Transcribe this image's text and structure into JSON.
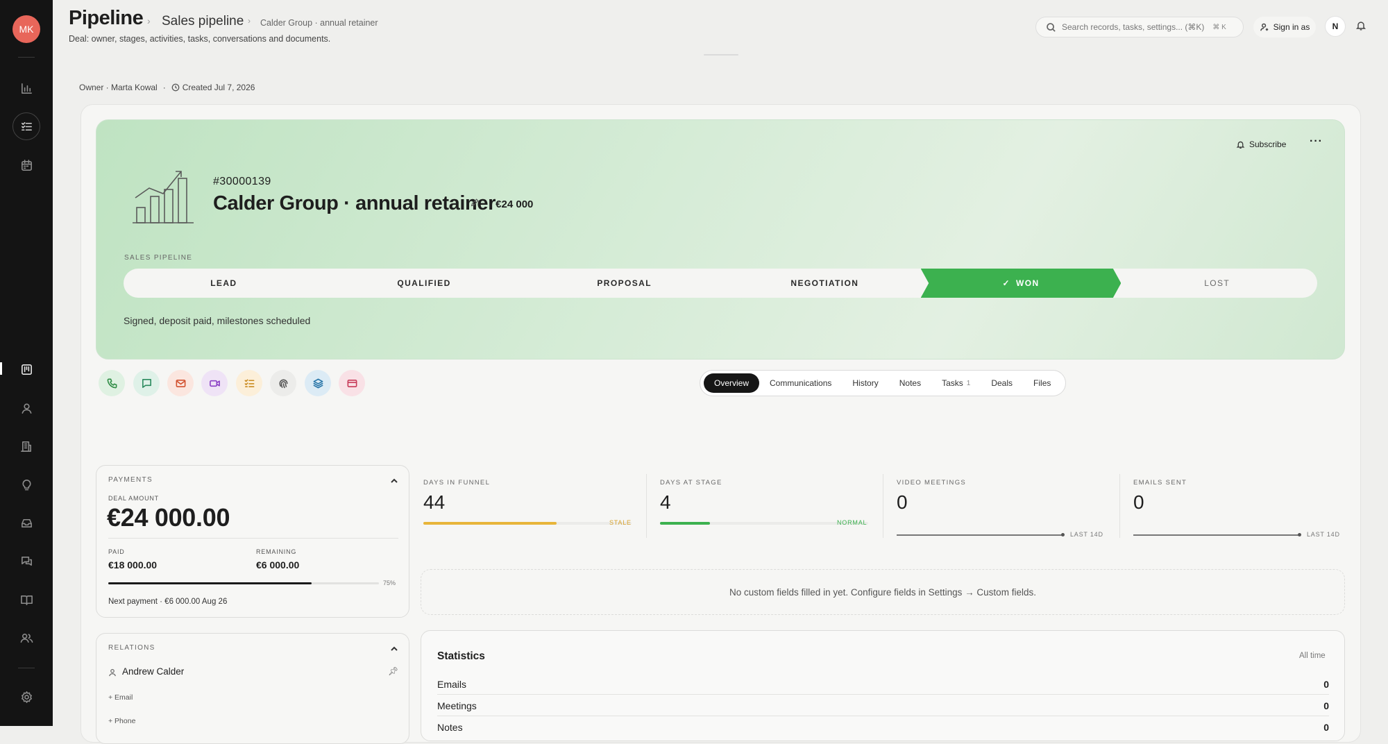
{
  "rail": {
    "avatar": "MK",
    "items": [
      "analytics-icon",
      "tasks-icon",
      "calendar-icon",
      "kanban-icon",
      "contacts-icon",
      "companies-icon",
      "ideas-icon",
      "inbox-icon",
      "chats-icon",
      "knowledge-icon",
      "team-icon",
      "settings-icon"
    ]
  },
  "header": {
    "title": "Pipeline",
    "crumb1": "Sales pipeline",
    "crumb2": "Calder Group · annual retainer",
    "subtitle": "Deal: owner, stages, activities, tasks, conversations and documents.",
    "search_placeholder": "Search records, tasks, settings... (⌘K)",
    "search_shortcut": "⌘ K",
    "sign_in_as": "Sign in as",
    "user_initial": "N"
  },
  "meta": {
    "owner": "Owner · Marta Kowal",
    "sep": "·",
    "created": "Created Jul 7, 2026"
  },
  "deal": {
    "number": "#30000139",
    "name": "Calder Group · annual retainer",
    "amount": "· €24 000",
    "subscribe": "Subscribe",
    "pipeline_label": "SALES PIPELINE",
    "stages": [
      "LEAD",
      "QUALIFIED",
      "PROPOSAL",
      "NEGOTIATION",
      "WON",
      "LOST"
    ],
    "current_stage": "WON",
    "note": "Signed, deposit paid, milestones scheduled"
  },
  "actions": [
    "phone-icon",
    "chat-icon",
    "mail-icon",
    "video-icon",
    "checklist-icon",
    "fingerprint-icon",
    "layers-icon",
    "card-icon"
  ],
  "tabs": [
    {
      "label": "Overview",
      "active": true
    },
    {
      "label": "Communications"
    },
    {
      "label": "History"
    },
    {
      "label": "Notes"
    },
    {
      "label": "Tasks",
      "count": "1"
    },
    {
      "label": "Deals"
    },
    {
      "label": "Files"
    }
  ],
  "payments": {
    "title": "PAYMENTS",
    "deal_amount_label": "DEAL AMOUNT",
    "deal_amount": "€24 000.00",
    "paid_label": "PAID",
    "paid": "€18 000.00",
    "remaining_label": "REMAINING",
    "remaining": "€6 000.00",
    "progress": 75,
    "progress_label": "75%",
    "next": "Next payment · €6 000.00 Aug 26"
  },
  "stats": [
    {
      "label": "DAYS IN FUNNEL",
      "value": "44",
      "status": "STALE",
      "fill": 0.64,
      "color": "#e8b53a"
    },
    {
      "label": "DAYS AT STAGE",
      "value": "4",
      "status": "NORMAL",
      "fill": 0.24,
      "color": "#3cb14f"
    },
    {
      "label": "VIDEO MEETINGS",
      "value": "0",
      "status": "LAST 14D"
    },
    {
      "label": "EMAILS SENT",
      "value": "0",
      "status": "LAST 14D"
    }
  ],
  "custom_fields": "No custom fields filled in yet. Configure fields in Settings → Custom fields.",
  "relations": {
    "title": "RELATIONS",
    "person": "Andrew Calder",
    "add_email": "+ Email",
    "add_phone": "+ Phone"
  },
  "statistics": {
    "title": "Statistics",
    "range": "All time",
    "rows": [
      {
        "label": "Emails",
        "value": "0"
      },
      {
        "label": "Meetings",
        "value": "0"
      },
      {
        "label": "Notes",
        "value": "0"
      }
    ]
  }
}
